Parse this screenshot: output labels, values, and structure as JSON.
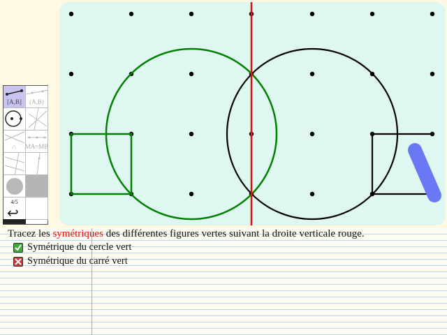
{
  "toolbox": {
    "segment_label": "[A,B]",
    "line_label": "(A,B)",
    "arc_label": "∩",
    "midpoint_label": "MA=MB",
    "page_label": "4/5",
    "undo_label": "↩"
  },
  "instructions": {
    "text_before": "Tracez les ",
    "highlight": "symétriques",
    "text_after": " des différentes figures vertes suivant la droite verticale rouge."
  },
  "tasks": [
    {
      "label": "Symétrique du cercle vert",
      "status": "correct"
    },
    {
      "label": "Symétrique du carré vert",
      "status": "incorrect"
    }
  ],
  "colors": {
    "given_figure": "#008000",
    "axis": "#e01010",
    "drawn_figure": "#000000",
    "highlighter": "#6a78f5",
    "board": "#dff7f1"
  }
}
